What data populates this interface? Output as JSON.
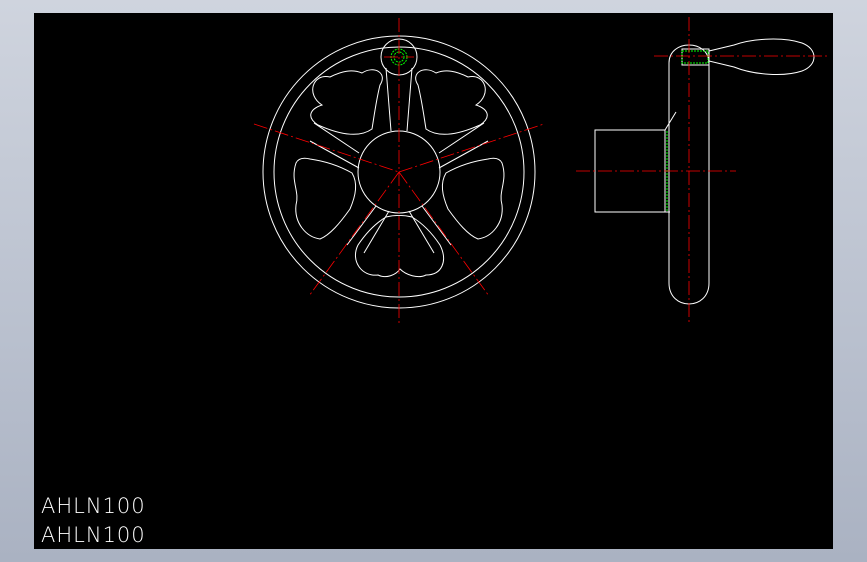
{
  "viewport": {
    "background": "#000000",
    "line_color": "#ffffff",
    "centerline_color": "#ff0000",
    "hidden_line_color": "#00ff00"
  },
  "labels": {
    "line1": "AHLN100",
    "line2": "AHLN100"
  }
}
